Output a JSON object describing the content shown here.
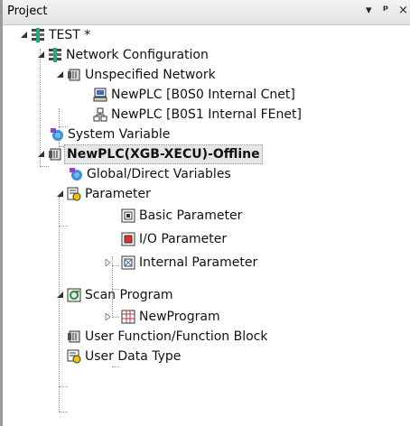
{
  "panel": {
    "title": "Project",
    "dropdown_icon": "▾",
    "pin_icon": "ᵖ",
    "close_icon": "×"
  },
  "tree": {
    "root_label": "TEST *",
    "network_config_label": "Network Configuration",
    "unspecified_network_label": "Unspecified Network",
    "plc_cnet_label": "NewPLC [B0S0 Internal Cnet]",
    "plc_fenet_label": "NewPLC [B0S1 Internal FEnet]",
    "system_variable_label": "System Variable",
    "plc_label": "NewPLC(XGB-XECU)-Offline",
    "global_vars_label": "Global/Direct Variables",
    "parameter_label": "Parameter",
    "basic_param_label": "Basic Parameter",
    "io_param_label": "I/O Parameter",
    "internal_param_label": "Internal Parameter",
    "scan_program_label": "Scan Program",
    "new_program_label": "NewProgram",
    "user_function_label": "User Function/Function Block",
    "user_data_type_label": "User Data Type"
  }
}
